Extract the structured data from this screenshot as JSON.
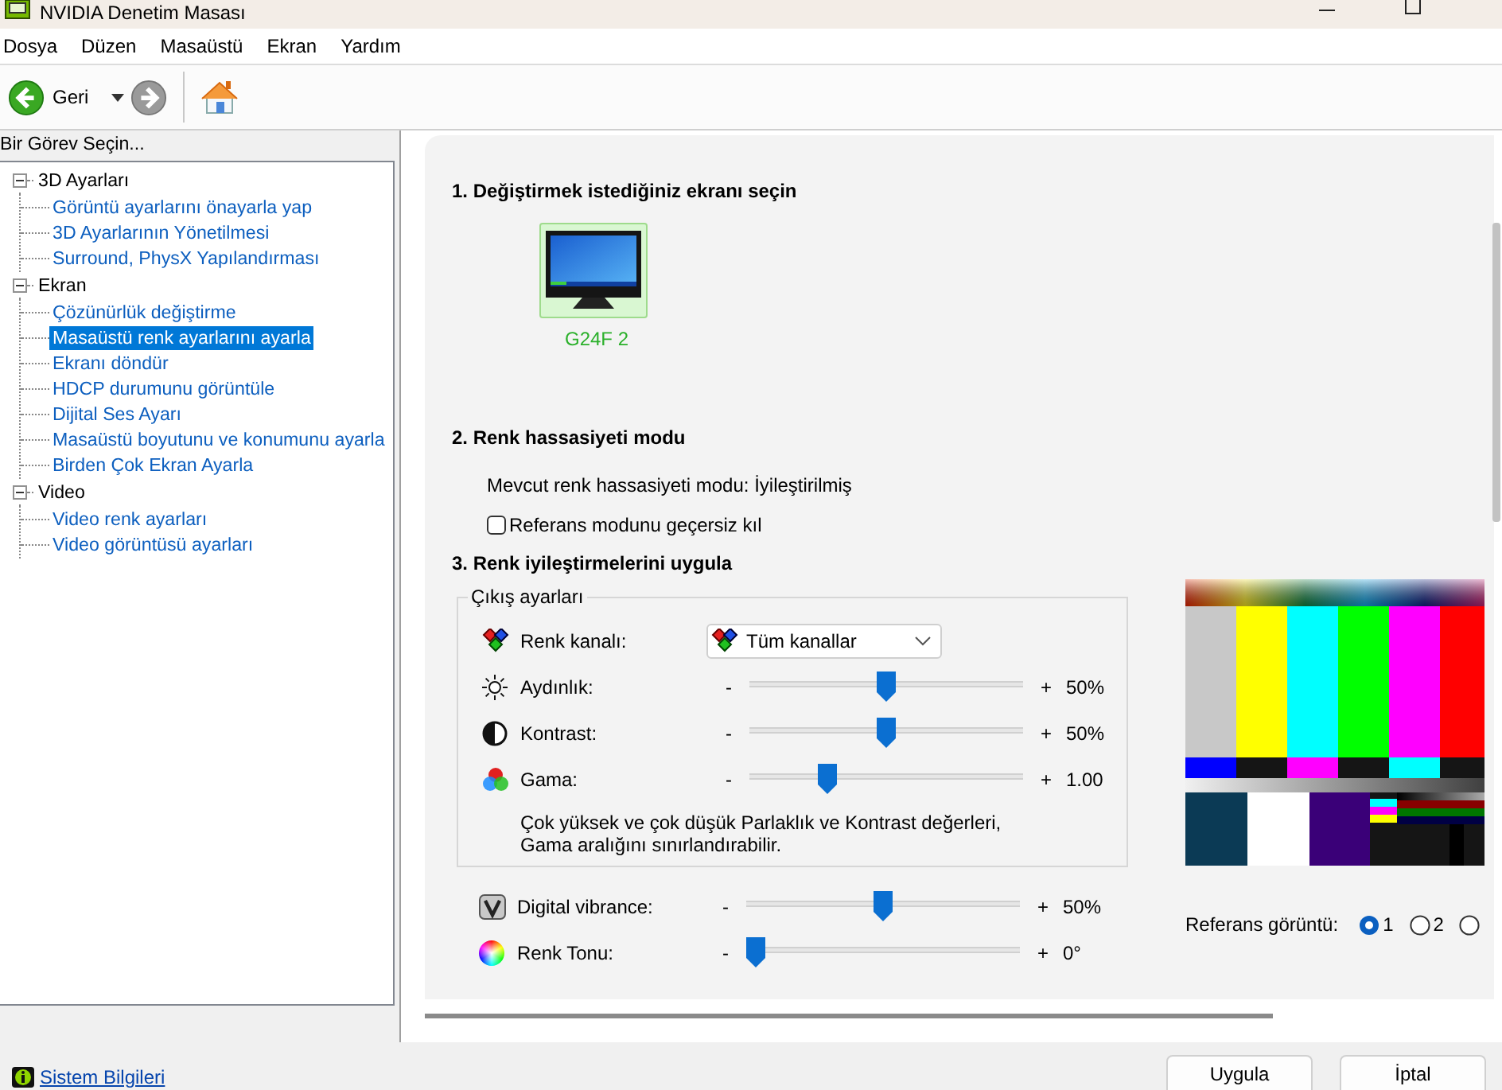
{
  "window": {
    "title": "NVIDIA Denetim Masası"
  },
  "menu": [
    "Dosya",
    "Düzen",
    "Masaüstü",
    "Ekran",
    "Yardım"
  ],
  "toolbar": {
    "back_label": "Geri"
  },
  "task_panel": {
    "heading": "Bir Görev Seçin...",
    "tree": [
      {
        "label": "3D Ayarları",
        "expanded": true,
        "selected": false,
        "children": [
          {
            "label": "Görüntü ayarlarını önayarla yap",
            "selected": false
          },
          {
            "label": "3D Ayarlarının Yönetilmesi",
            "selected": false
          },
          {
            "label": "Surround, PhysX Yapılandırması",
            "selected": false
          }
        ]
      },
      {
        "label": "Ekran",
        "expanded": true,
        "selected": false,
        "children": [
          {
            "label": "Çözünürlük değiştirme",
            "selected": false
          },
          {
            "label": "Masaüstü renk ayarlarını ayarla",
            "selected": true
          },
          {
            "label": "Ekranı döndür",
            "selected": false
          },
          {
            "label": "HDCP durumunu görüntüle",
            "selected": false
          },
          {
            "label": "Dijital Ses Ayarı",
            "selected": false
          },
          {
            "label": "Masaüstü boyutunu ve konumunu ayarla",
            "selected": false
          },
          {
            "label": "Birden Çok Ekran Ayarla",
            "selected": false
          }
        ]
      },
      {
        "label": "Video",
        "expanded": true,
        "selected": false,
        "children": [
          {
            "label": "Video renk ayarları",
            "selected": false
          },
          {
            "label": "Video görüntüsü ayarları",
            "selected": false
          }
        ]
      }
    ]
  },
  "section_1": {
    "title": "1. Değiştirmek istediğiniz ekranı seçin",
    "displays": [
      {
        "label": "G24F 2",
        "selected": true
      }
    ]
  },
  "section_2": {
    "title": "2. Renk hassasiyeti modu",
    "current_mode": "Mevcut renk hassasiyeti modu: İyileştirilmiş",
    "override": {
      "label": "Referans modunu geçersiz kıl",
      "checked": false
    }
  },
  "section_3": {
    "title": "3. Renk iyileştirmelerini uygula",
    "output_group": {
      "title": "Çıkış ayarları",
      "channel": {
        "label": "Renk kanalı:",
        "value": "Tüm kanallar"
      },
      "sliders": [
        {
          "kind": "brightness",
          "label": "Aydınlık:",
          "minus": "-",
          "plus": "+",
          "level": 0.5,
          "reading": "50%"
        },
        {
          "kind": "contrast",
          "label": "Kontrast:",
          "minus": "-",
          "plus": "+",
          "level": 0.5,
          "reading": "50%"
        },
        {
          "kind": "gamma",
          "label": "Gama:",
          "minus": "-",
          "plus": "+",
          "level": 0.27,
          "reading": "1.00"
        }
      ],
      "note": "Çok yüksek ve çok düşük Parlaklık ve Kontrast değerleri, Gama aralığını sınırlandırabilir."
    },
    "sliders": [
      {
        "kind": "vibrance",
        "label": "Digital vibrance:",
        "minus": "-",
        "plus": "+",
        "level": 0.5,
        "reading": "50%"
      },
      {
        "kind": "hue",
        "label": "Renk Tonu:",
        "minus": "-",
        "plus": "+",
        "level": 0,
        "reading": "0°"
      }
    ],
    "reference": {
      "label": "Referans görüntü:",
      "options": [
        {
          "label": "1",
          "selected": true
        },
        {
          "label": "2",
          "selected": false
        },
        {
          "selected": false
        }
      ]
    }
  },
  "footer": {
    "link": "Sistem Bilgileri",
    "buttons": [
      "Uygula",
      "İptal"
    ]
  }
}
